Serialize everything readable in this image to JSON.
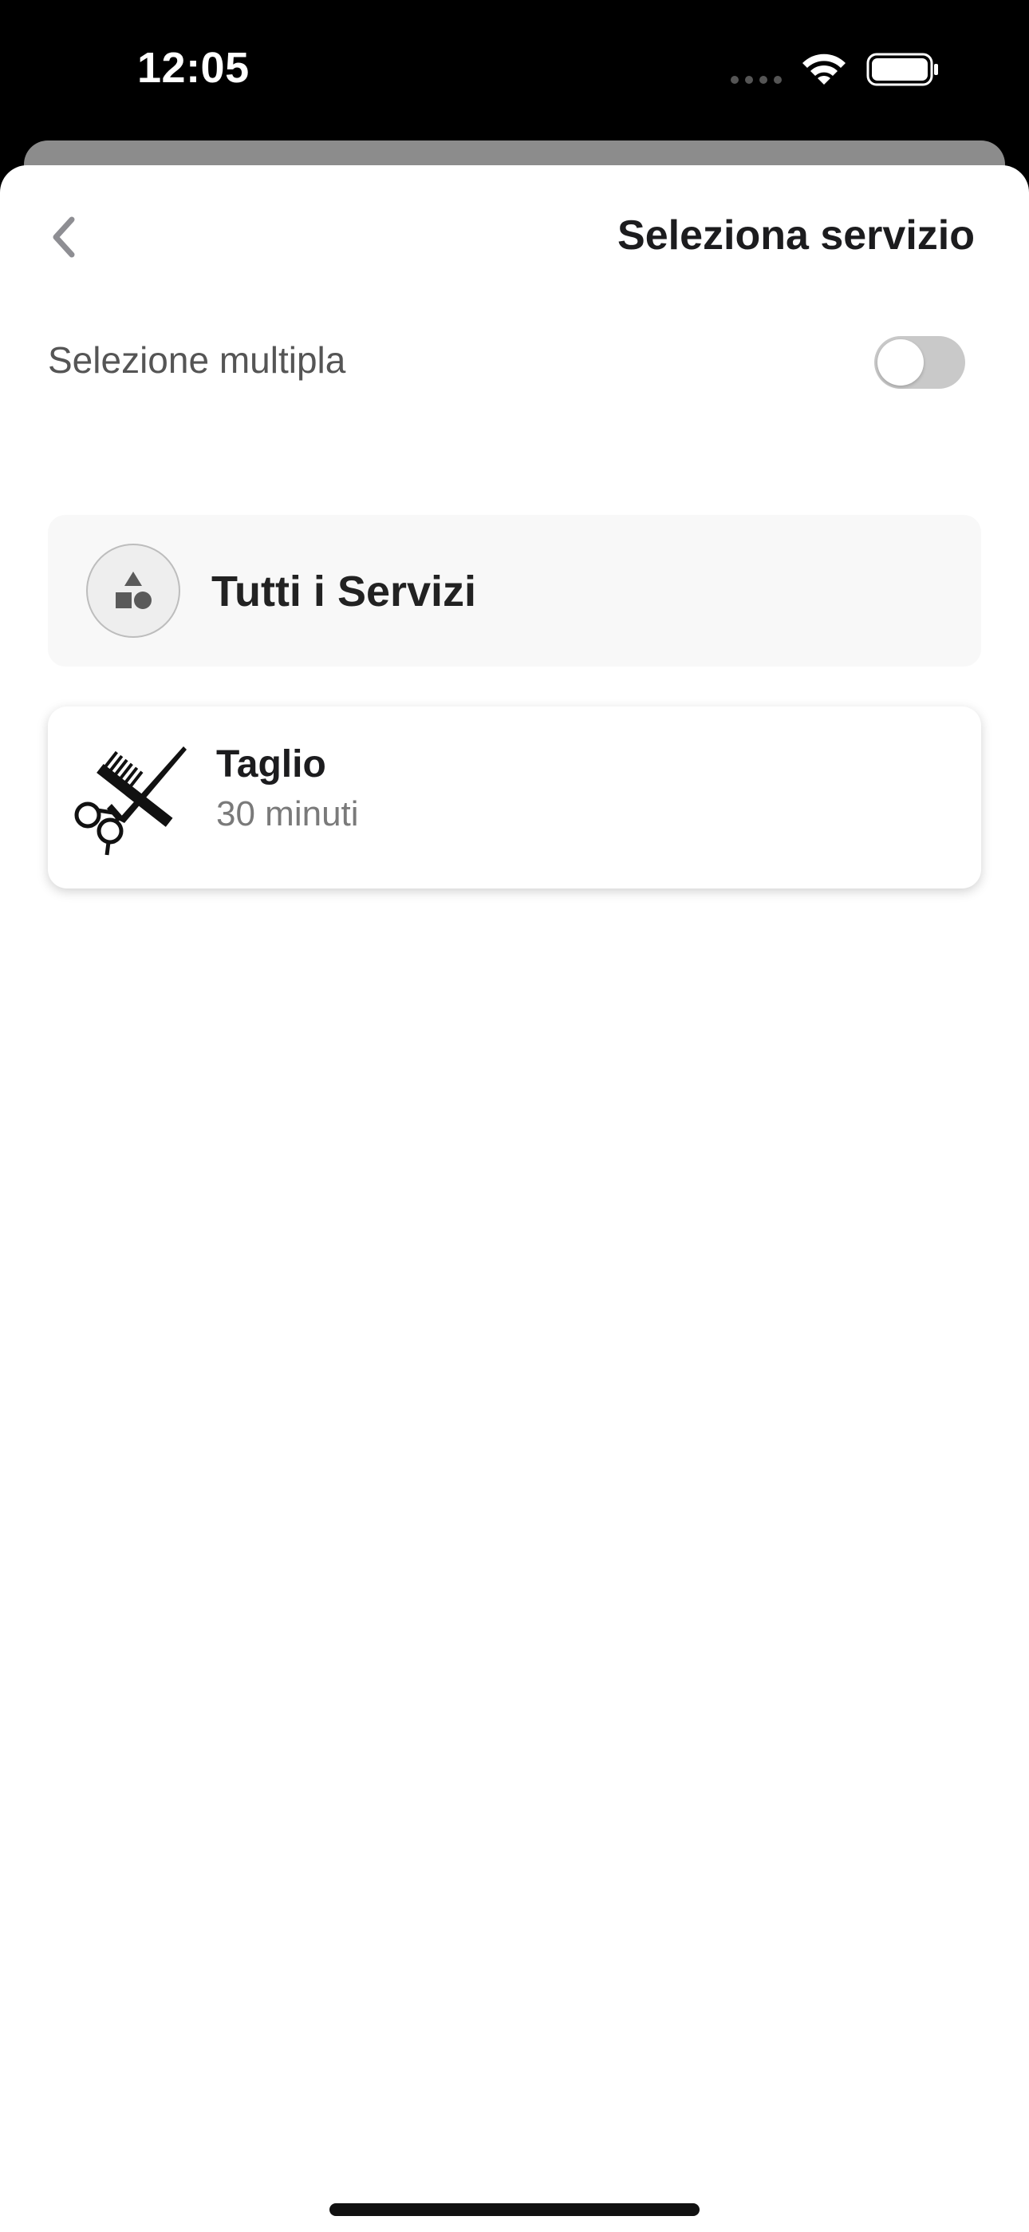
{
  "status_bar": {
    "time": "12:05"
  },
  "header": {
    "title": "Seleziona servizio",
    "back_icon": "chevron-left-icon"
  },
  "multi_select": {
    "label": "Selezione multipla",
    "enabled": false
  },
  "all_services": {
    "label": "Tutti i Servizi",
    "icon": "shapes-icon"
  },
  "services": [
    {
      "name": "Taglio",
      "duration": "30 minuti",
      "icon": "comb-scissors-icon"
    }
  ],
  "colors": {
    "toggle_off": "#c9c9c9",
    "title": "#1c1c1e",
    "secondary_text": "#7a7a7a"
  }
}
